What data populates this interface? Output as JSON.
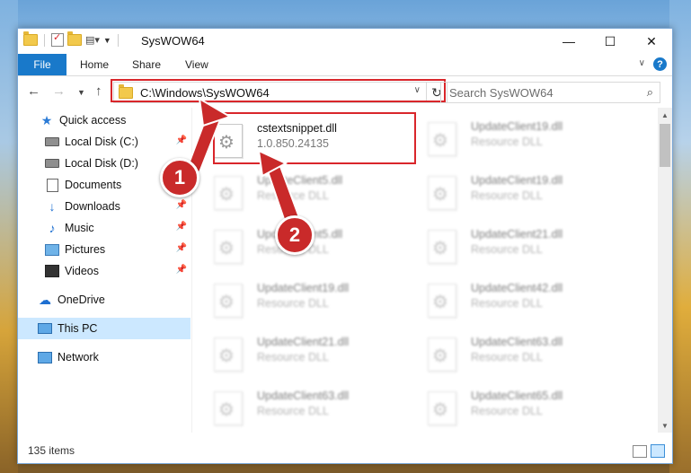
{
  "window": {
    "title": "SysWOW64"
  },
  "ribbon": {
    "tabs": [
      "File",
      "Home",
      "Share",
      "View"
    ]
  },
  "address": {
    "path": "C:\\Windows\\SysWOW64",
    "search_placeholder": "Search SysWOW64"
  },
  "nav": [
    {
      "label": "Quick access",
      "icon": "star-icon",
      "pinned": false
    },
    {
      "label": "Local Disk (C:)",
      "icon": "disk-icon",
      "pinned": true
    },
    {
      "label": "Local Disk (D:)",
      "icon": "disk-icon",
      "pinned": false
    },
    {
      "label": "Documents",
      "icon": "documents-icon",
      "pinned": false
    },
    {
      "label": "Downloads",
      "icon": "downloads-icon",
      "pinned": true
    },
    {
      "label": "Music",
      "icon": "music-icon",
      "pinned": true
    },
    {
      "label": "Pictures",
      "icon": "pictures-icon",
      "pinned": true
    },
    {
      "label": "Videos",
      "icon": "videos-icon",
      "pinned": true
    },
    {
      "label": "OneDrive",
      "icon": "onedrive-icon",
      "pinned": false
    },
    {
      "label": "This PC",
      "icon": "this-pc-icon",
      "pinned": false,
      "selected": true
    },
    {
      "label": "Network",
      "icon": "network-icon",
      "pinned": false
    }
  ],
  "files": {
    "left": [
      {
        "name": "cstextsnippet.dll",
        "sub": "1.0.850.24135",
        "highlighted": true
      },
      {
        "name": "UpdateClient5.dll",
        "sub": "Resource DLL"
      },
      {
        "name": "UpdateClient5.dll",
        "sub": "Resource DLL"
      },
      {
        "name": "UpdateClient19.dll",
        "sub": "Resource DLL"
      },
      {
        "name": "UpdateClient21.dll",
        "sub": "Resource DLL"
      },
      {
        "name": "UpdateClient63.dll",
        "sub": "Resource DLL"
      }
    ],
    "right": [
      {
        "name": "UpdateClient19.dll",
        "sub": "Resource DLL"
      },
      {
        "name": "UpdateClient19.dll",
        "sub": "Resource DLL"
      },
      {
        "name": "UpdateClient21.dll",
        "sub": "Resource DLL"
      },
      {
        "name": "UpdateClient42.dll",
        "sub": "Resource DLL"
      },
      {
        "name": "UpdateClient63.dll",
        "sub": "Resource DLL"
      },
      {
        "name": "UpdateClient65.dll",
        "sub": "Resource DLL"
      }
    ]
  },
  "status": {
    "items": "135 items"
  },
  "callouts": [
    "1",
    "2"
  ],
  "colors": {
    "accent": "#1979ca",
    "highlight": "#d9262b",
    "selected": "#cce8ff"
  }
}
